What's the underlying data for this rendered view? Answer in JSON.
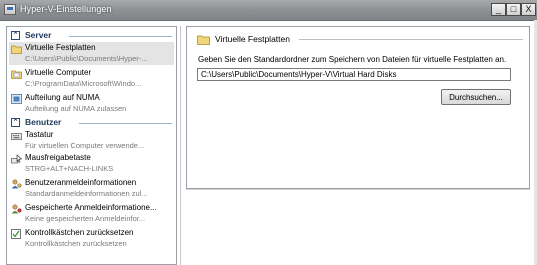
{
  "window": {
    "title": "Hyper-V-Einstellungen",
    "controls": {
      "minimize": "_",
      "maximize": "□",
      "close": "X"
    }
  },
  "nav": {
    "sections": [
      {
        "header": "Server",
        "items": [
          {
            "title": "Virtuelle Festplatten",
            "subtitle": "C:\\Users\\Public\\Documents\\Hyper-...",
            "icon": "folder-icon",
            "selected": true
          },
          {
            "title": "Virtuelle Computer",
            "subtitle": "C:\\ProgramData\\Microsoft\\Windo...",
            "icon": "folder-doc-icon",
            "selected": false
          },
          {
            "title": "Aufteilung auf NUMA",
            "subtitle": "Aufteilung auf NUMA zulassen",
            "icon": "numa-icon",
            "selected": false
          }
        ]
      },
      {
        "header": "Benutzer",
        "items": [
          {
            "title": "Tastatur",
            "subtitle": "Für virtuellen Computer verwende...",
            "icon": "keyboard-icon"
          },
          {
            "title": "Mausfreigabetaste",
            "subtitle": "STRG+ALT+NACH-LINKS",
            "icon": "mouse-release-icon"
          },
          {
            "title": "Benutzeranmeldeinformationen",
            "subtitle": "Standardanmeldeinformationen zul...",
            "icon": "credentials-icon"
          },
          {
            "title": "Gespeicherte Anmeldeinformatione...",
            "subtitle": "Keine gespeicherten Anmeldeinfor...",
            "icon": "saved-credentials-icon"
          },
          {
            "title": "Kontrollkästchen zurücksetzen",
            "subtitle": "Kontrollkästchen zurücksetzen",
            "icon": "reset-checkbox-icon"
          }
        ]
      }
    ]
  },
  "detail": {
    "title": "Virtuelle Festplatten",
    "description": "Geben Sie den Standardordner zum Speichern von Dateien für virtuelle Festplatten an.",
    "path_value": "C:\\Users\\Public\\Documents\\Hyper-V\\Virtual Hard Disks",
    "browse_label": "Durchsuchen..."
  },
  "colors": {
    "titlebar": "#8e9194",
    "header_text": "#1e395b",
    "selected_bg": "#e4e4e4",
    "subtext": "#7a7a7a"
  }
}
